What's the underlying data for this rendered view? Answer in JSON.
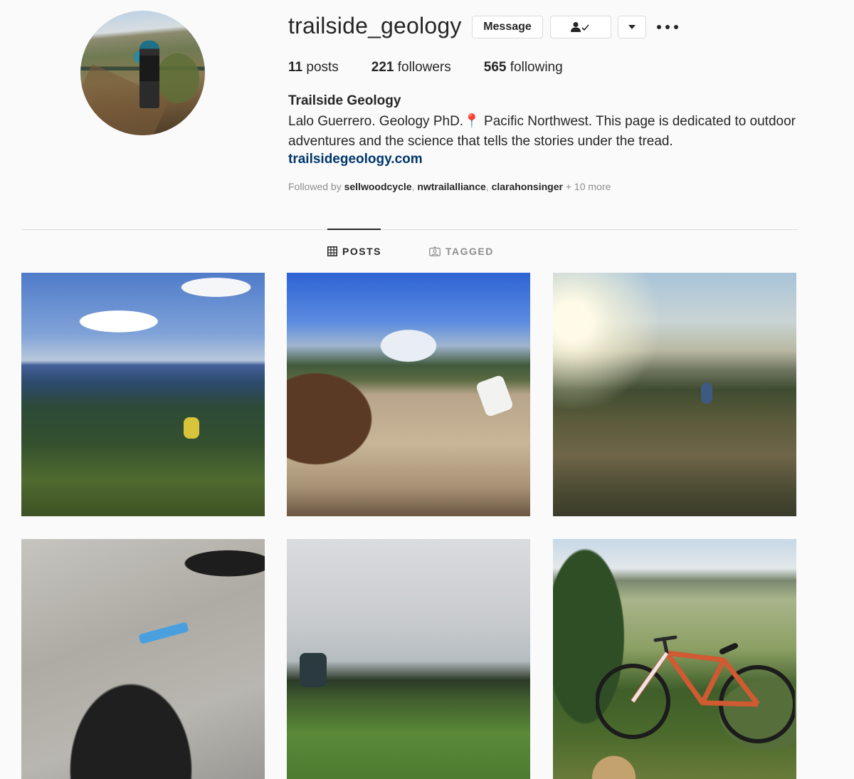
{
  "profile": {
    "username": "trailside_geology",
    "avatar_icon": "profile-photo-trail-rider",
    "buttons": {
      "message_label": "Message",
      "following_icon": "user-check-icon",
      "dropdown_icon": "caret-down-icon",
      "more_icon": "more-horizontal-icon"
    },
    "stats": {
      "posts_count": "11",
      "posts_label": "posts",
      "followers_count": "221",
      "followers_label": "followers",
      "following_count": "565",
      "following_label": "following"
    },
    "full_name": "Trailside Geology",
    "bio_line1": "Lalo Guerrero. Geology PhD.",
    "bio_pin_icon": "📍",
    "bio_line1_rest": "Pacific Northwest. This page is dedicated to outdoor",
    "bio_line2": "adventures and the science that tells the stories under the tread.",
    "website": "trailsidegeology.com",
    "followed_by": {
      "prefix": "Followed by",
      "users": [
        "sellwoodcycle",
        "nwtrailalliance",
        "clarahonsinger"
      ],
      "more": "+ 10 more"
    }
  },
  "tabs": [
    {
      "label": "POSTS",
      "icon": "grid-icon",
      "active": true
    },
    {
      "label": "TAGGED",
      "icon": "tagged-icon",
      "active": false
    }
  ],
  "posts": [
    {
      "icon": "photo-mountain-ridge-rider"
    },
    {
      "icon": "photo-berm-volcano-rider"
    },
    {
      "icon": "photo-sunset-meadow-rider"
    },
    {
      "icon": "photo-gloved-hand-rocks"
    },
    {
      "icon": "photo-overcast-meadow-rider"
    },
    {
      "icon": "photo-orange-bike-juniper"
    }
  ]
}
